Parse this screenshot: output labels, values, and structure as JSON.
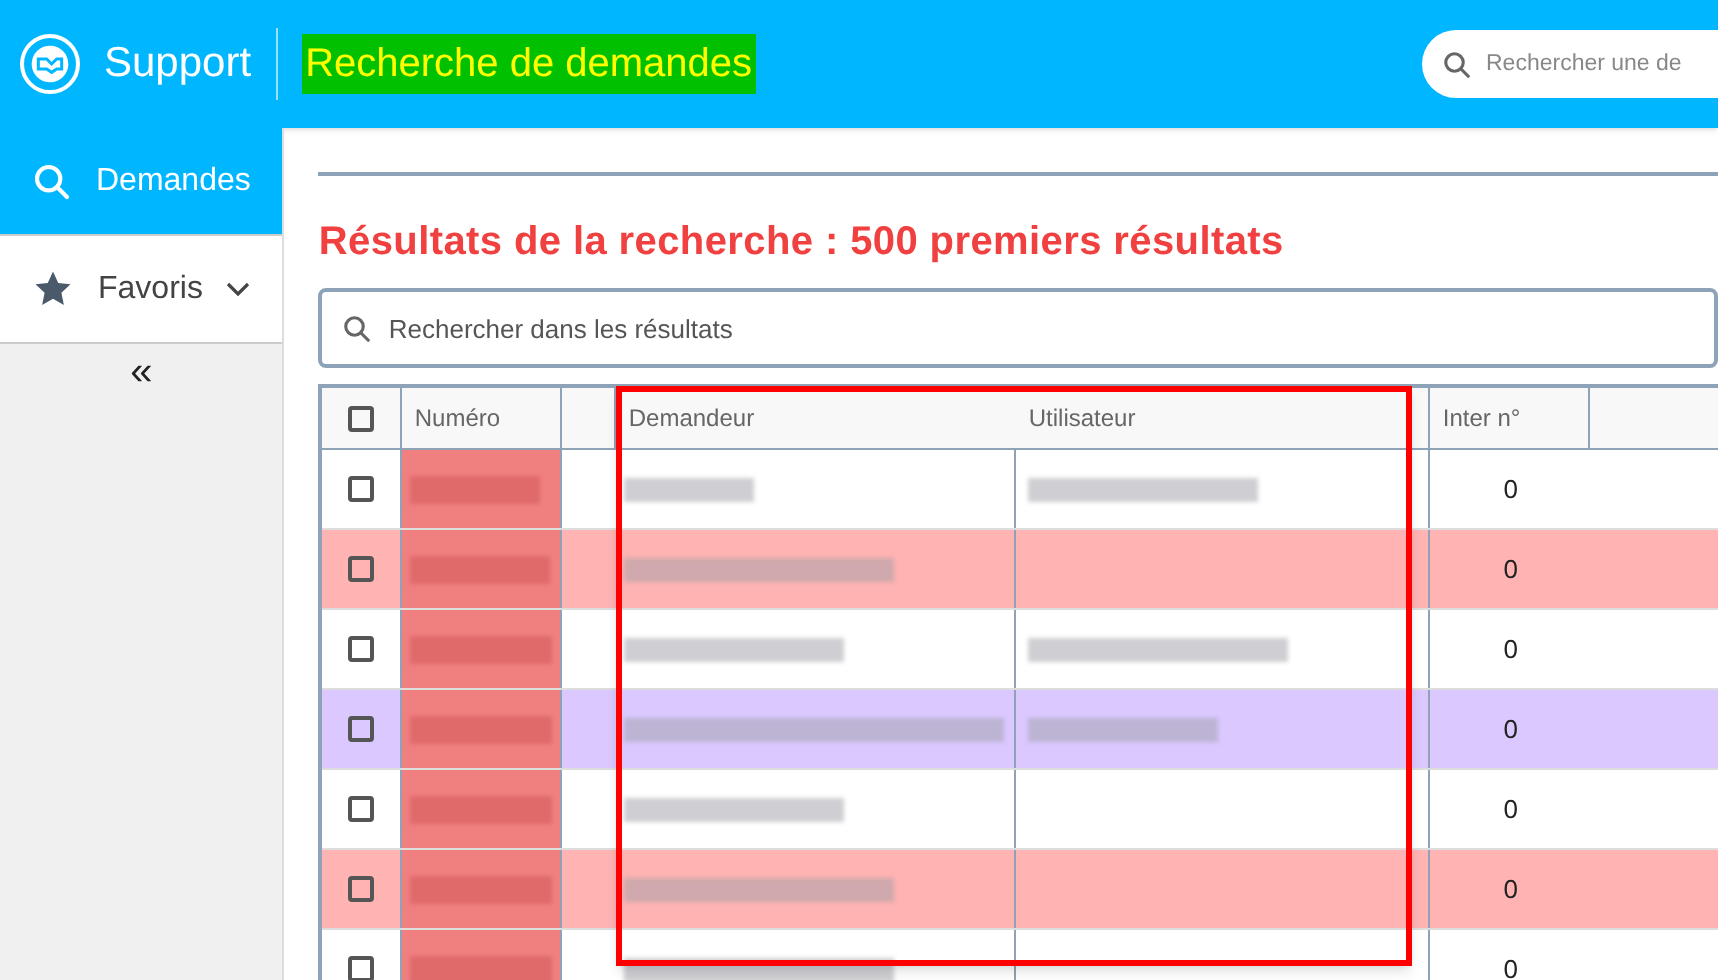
{
  "header": {
    "app_name": "Support",
    "page_title": "Recherche de demandes",
    "search": {
      "placeholder": "Rechercher une de"
    }
  },
  "sidebar": {
    "items": [
      {
        "label": "Demandes",
        "kind": "search",
        "selected": true,
        "expandable": false
      },
      {
        "label": "Favoris",
        "kind": "star",
        "selected": false,
        "expandable": true
      }
    ],
    "collapse": "«"
  },
  "results": {
    "title": "Résultats de la recherche : 500 premiers résultats",
    "search": {
      "placeholder": "Rechercher dans les résultats"
    }
  },
  "table": {
    "all_checked": false,
    "columns": [
      "Numéro",
      "",
      "Demandeur",
      "Utilisateur",
      "Inter n°"
    ],
    "rows": [
      {
        "checked": false,
        "color": "#ffffff",
        "numero_redacted": true,
        "demandeur_redacted": true,
        "utilisateur_redacted": true,
        "inter": "0"
      },
      {
        "checked": false,
        "color": "#ffb3b3",
        "numero_redacted": true,
        "demandeur_redacted": true,
        "utilisateur_redacted": false,
        "inter": "0"
      },
      {
        "checked": false,
        "color": "#ffffff",
        "numero_redacted": true,
        "demandeur_redacted": true,
        "utilisateur_redacted": true,
        "inter": "0"
      },
      {
        "checked": false,
        "color": "#dac8ff",
        "numero_redacted": true,
        "demandeur_redacted": true,
        "utilisateur_redacted": true,
        "inter": "0"
      },
      {
        "checked": false,
        "color": "#ffffff",
        "numero_redacted": true,
        "demandeur_redacted": true,
        "utilisateur_redacted": false,
        "inter": "0"
      },
      {
        "checked": false,
        "color": "#ffb3b3",
        "numero_redacted": true,
        "demandeur_redacted": true,
        "utilisateur_redacted": false,
        "inter": "0"
      },
      {
        "checked": false,
        "color": "#ffffff",
        "numero_redacted": true,
        "demandeur_redacted": true,
        "utilisateur_redacted": false,
        "inter": "0"
      }
    ]
  }
}
